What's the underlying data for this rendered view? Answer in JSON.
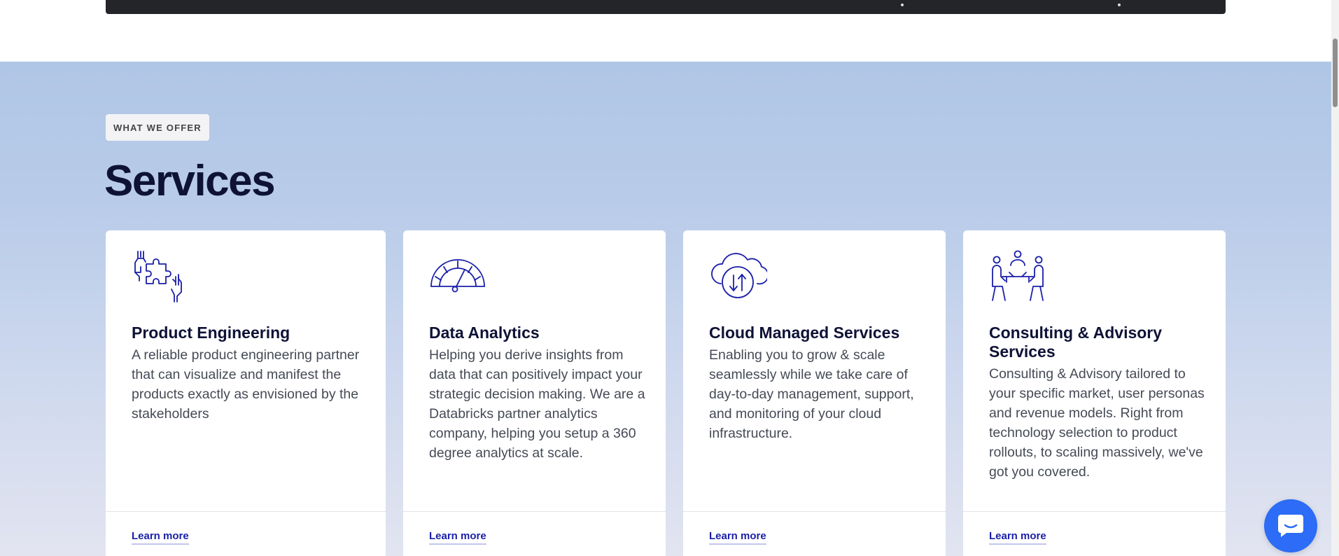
{
  "colors": {
    "accent": "#1a1fa8",
    "heading": "#0e1236",
    "chat": "#2c6cf6",
    "banner": "#242528"
  },
  "section": {
    "tag": "WHAT WE OFFER",
    "title": "Services"
  },
  "cards": [
    {
      "icon": "puzzle-hands-icon",
      "title": "Product Engineering",
      "description": "A reliable product engineering partner that can visualize and manifest the products exactly as envisioned by the stakeholders",
      "link": "Learn more"
    },
    {
      "icon": "speedometer-gauge-icon",
      "title": "Data Analytics",
      "description": "Helping you derive insights from data that can positively impact your strategic decision making. We are a Databricks partner analytics company, helping you setup a 360 degree analytics at scale.",
      "link": "Learn more"
    },
    {
      "icon": "cloud-transfer-icon",
      "title": "Cloud Managed Services",
      "description": "Enabling you to grow & scale seamlessly while we take care of day-to-day management, support, and monitoring of your cloud infrastructure.",
      "link": "Learn more"
    },
    {
      "icon": "meeting-table-icon",
      "title": "Consulting & Advisory Services",
      "description": "Consulting & Advisory tailored to your specific market, user personas and revenue models. Right from technology selection to product rollouts, to scaling massively, we've got you covered.",
      "link": "Learn more"
    }
  ],
  "chat": {
    "icon": "chat-bubble-icon"
  }
}
